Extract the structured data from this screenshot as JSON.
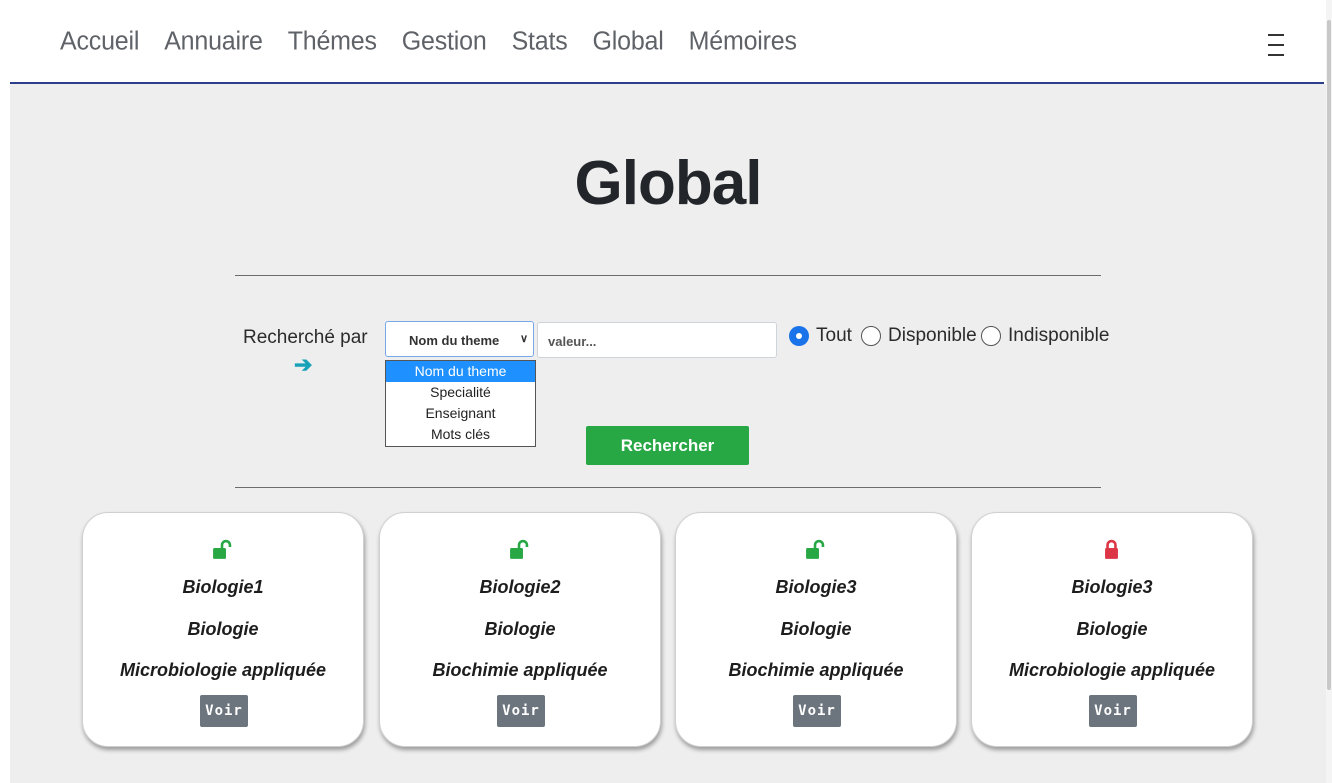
{
  "nav": {
    "links": [
      "Accueil",
      "Annuaire",
      "Thémes",
      "Gestion",
      "Stats",
      "Global",
      "Mémoires"
    ],
    "menu_icon": "hamburger-icon"
  },
  "page": {
    "title": "Global"
  },
  "search": {
    "label": "Recherché par",
    "arrow_icon": "arrow-right-icon",
    "select_value": "Nom du theme",
    "options": [
      "Nom du theme",
      "Specialité",
      "Enseignant",
      "Mots clés"
    ],
    "input_placeholder": "valeur...",
    "radios": [
      {
        "label": "Tout",
        "checked": true
      },
      {
        "label": "Disponible",
        "checked": false
      },
      {
        "label": "Indisponible",
        "checked": false
      }
    ],
    "button_label": "Rechercher"
  },
  "cards": [
    {
      "title": "Biologie1",
      "field": "Biologie",
      "speciality": "Microbiologie appliquée",
      "status": "unlocked",
      "button": "Voir"
    },
    {
      "title": "Biologie2",
      "field": "Biologie",
      "speciality": "Biochimie appliquée",
      "status": "unlocked",
      "button": "Voir"
    },
    {
      "title": "Biologie3",
      "field": "Biologie",
      "speciality": "Biochimie appliquée",
      "status": "unlocked",
      "button": "Voir"
    },
    {
      "title": "Biologie3",
      "field": "Biologie",
      "speciality": "Microbiologie appliquée",
      "status": "locked",
      "button": "Voir"
    }
  ],
  "colors": {
    "unlocked": "#28a745",
    "locked": "#dc3545",
    "search_button": "#28a745",
    "voir_button": "#6c757d",
    "nav_border": "#2b3f8c",
    "radio_checked": "#1a73e8"
  }
}
